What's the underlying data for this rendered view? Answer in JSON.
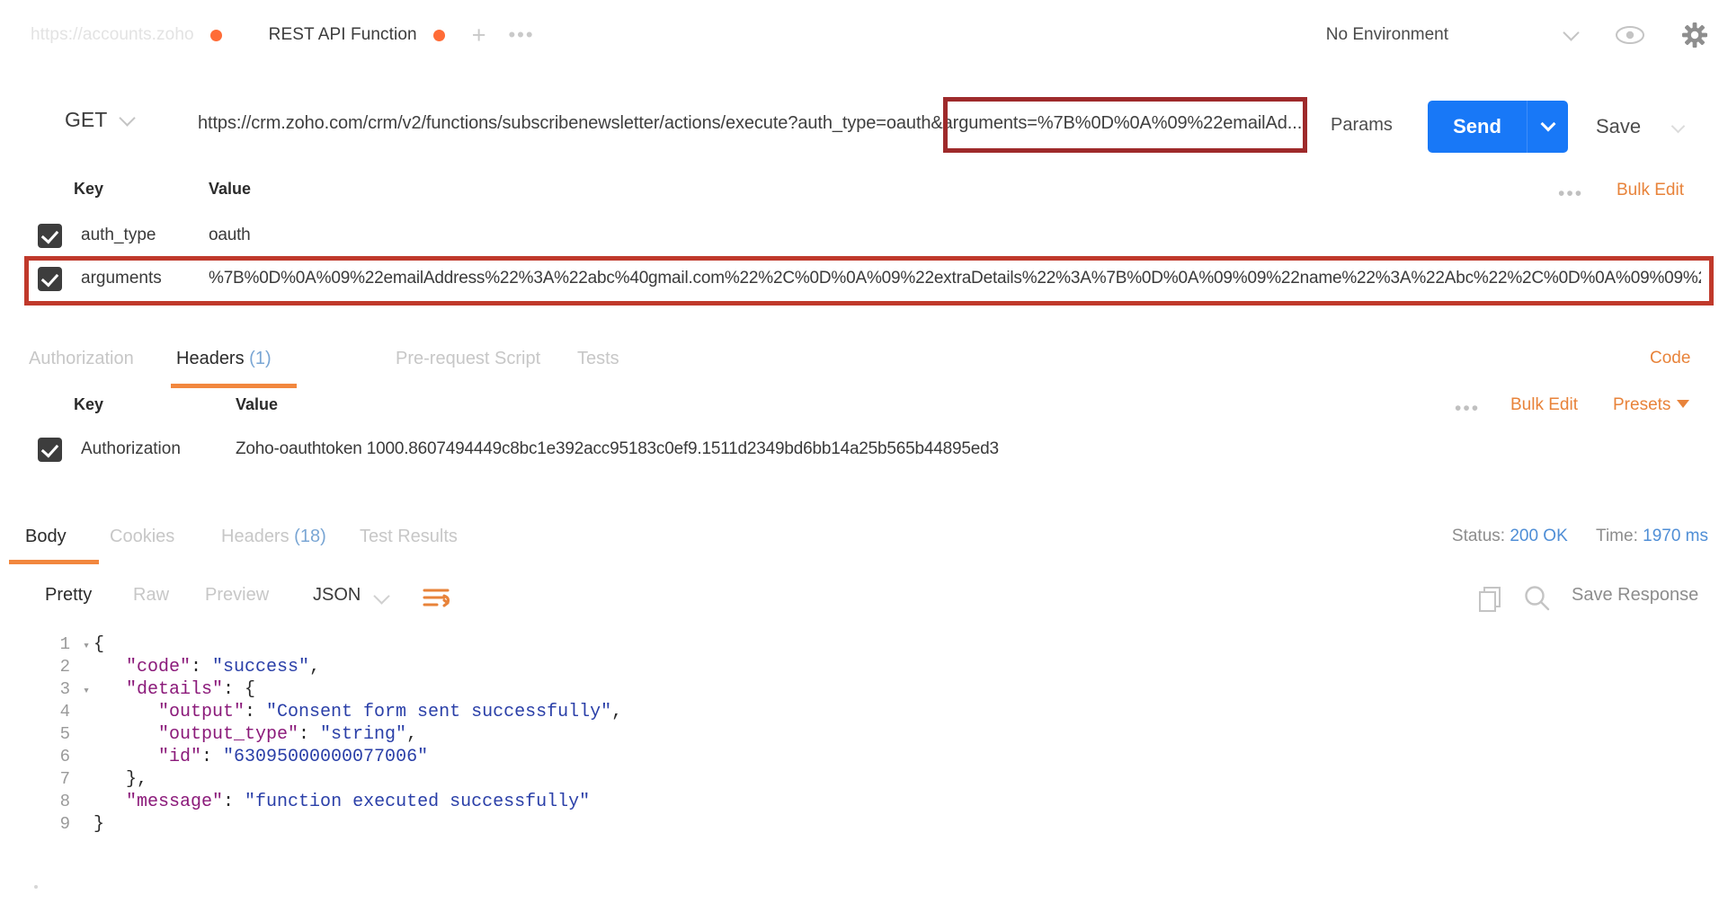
{
  "tabs": [
    {
      "label": "https://accounts.zoho",
      "state": "inactive",
      "dirty": true
    },
    {
      "label": "REST API Function",
      "state": "active",
      "dirty": true
    }
  ],
  "tabstrip": {
    "new_tab": "+",
    "more": "•••"
  },
  "environment": {
    "name": "No Environment",
    "chevron_icon": "chevron-down-icon",
    "eye_icon": "eye-icon",
    "gear_icon": "gear-icon"
  },
  "request": {
    "method": "GET",
    "url": "https://crm.zoho.com/crm/v2/functions/subscribenewsletter/actions/execute?auth_type=oauth&arguments=%7B%0D%0A%09%22emailAd...",
    "params_label": "Params",
    "send_label": "Send",
    "save_label": "Save",
    "highlight_color": "#9e2a2b"
  },
  "params_table": {
    "headers": {
      "key": "Key",
      "value": "Value"
    },
    "bulk_edit": "Bulk Edit",
    "more": "•••",
    "rows": [
      {
        "checked": true,
        "key": "auth_type",
        "value": "oauth",
        "highlighted": false
      },
      {
        "checked": true,
        "key": "arguments",
        "value": "%7B%0D%0A%09%22emailAddress%22%3A%22abc%40gmail.com%22%2C%0D%0A%09%22extraDetails%22%3A%7B%0D%0A%09%09%22name%22%3A%22Abc%22%2C%0D%0A%09%09%2...",
        "highlighted": true
      }
    ]
  },
  "request_tabs": [
    {
      "label": "Authorization",
      "active": false
    },
    {
      "label": "Headers",
      "count": "(1)",
      "active": true
    },
    {
      "label": "Pre-request Script",
      "active": false
    },
    {
      "label": "Tests",
      "active": false
    }
  ],
  "code_link": "Code",
  "headers_table": {
    "headers": {
      "key": "Key",
      "value": "Value"
    },
    "bulk_edit": "Bulk Edit",
    "presets": "Presets",
    "more": "•••",
    "rows": [
      {
        "checked": true,
        "key": "Authorization",
        "value": "Zoho-oauthtoken 1000.8607494449c8bc1e392acc95183c0ef9.1511d2349bd6bb14a25b565b44895ed3"
      }
    ]
  },
  "response_tabs": [
    {
      "label": "Body",
      "active": true
    },
    {
      "label": "Cookies",
      "active": false
    },
    {
      "label": "Headers",
      "count": "(18)",
      "active": false
    },
    {
      "label": "Test Results",
      "active": false
    }
  ],
  "response_status": {
    "status_label": "Status:",
    "status_value": "200 OK",
    "time_label": "Time:",
    "time_value": "1970 ms"
  },
  "response_toolbar": {
    "views": [
      {
        "label": "Pretty",
        "active": true
      },
      {
        "label": "Raw",
        "active": false
      },
      {
        "label": "Preview",
        "active": false
      }
    ],
    "format": "JSON",
    "format_chevron_icon": "chevron-down-icon",
    "wrap_icon": "word-wrap-icon",
    "copy_icon": "copy-icon",
    "search_icon": "search-icon",
    "save_response": "Save Response"
  },
  "response_body": {
    "lines": [
      {
        "n": "1",
        "fold": true,
        "segments": [
          {
            "t": "{",
            "c": "jpun"
          }
        ],
        "indent": 0
      },
      {
        "n": "2",
        "fold": false,
        "segments": [
          {
            "t": "\"code\"",
            "c": "jkey"
          },
          {
            "t": ": ",
            "c": "jpun"
          },
          {
            "t": "\"success\"",
            "c": "jstr"
          },
          {
            "t": ",",
            "c": "jpun"
          }
        ],
        "indent": 1
      },
      {
        "n": "3",
        "fold": true,
        "segments": [
          {
            "t": "\"details\"",
            "c": "jkey"
          },
          {
            "t": ": {",
            "c": "jpun"
          }
        ],
        "indent": 1
      },
      {
        "n": "4",
        "fold": false,
        "segments": [
          {
            "t": "\"output\"",
            "c": "jkey"
          },
          {
            "t": ": ",
            "c": "jpun"
          },
          {
            "t": "\"Consent form sent successfully\"",
            "c": "jstr"
          },
          {
            "t": ",",
            "c": "jpun"
          }
        ],
        "indent": 2
      },
      {
        "n": "5",
        "fold": false,
        "segments": [
          {
            "t": "\"output_type\"",
            "c": "jkey"
          },
          {
            "t": ": ",
            "c": "jpun"
          },
          {
            "t": "\"string\"",
            "c": "jstr"
          },
          {
            "t": ",",
            "c": "jpun"
          }
        ],
        "indent": 2
      },
      {
        "n": "6",
        "fold": false,
        "segments": [
          {
            "t": "\"id\"",
            "c": "jkey"
          },
          {
            "t": ": ",
            "c": "jpun"
          },
          {
            "t": "\"63095000000077006\"",
            "c": "jstr"
          }
        ],
        "indent": 2
      },
      {
        "n": "7",
        "fold": false,
        "segments": [
          {
            "t": "},",
            "c": "jpun"
          }
        ],
        "indent": 1
      },
      {
        "n": "8",
        "fold": false,
        "segments": [
          {
            "t": "\"message\"",
            "c": "jkey"
          },
          {
            "t": ": ",
            "c": "jpun"
          },
          {
            "t": "\"function executed successfully\"",
            "c": "jstr"
          }
        ],
        "indent": 1
      },
      {
        "n": "9",
        "fold": false,
        "segments": [
          {
            "t": "}",
            "c": "jpun"
          }
        ],
        "indent": 0
      }
    ]
  }
}
